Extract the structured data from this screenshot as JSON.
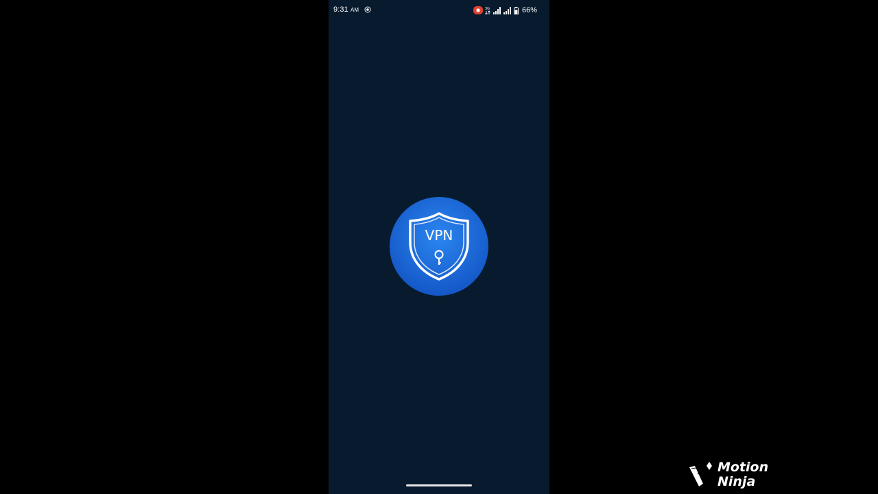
{
  "status_bar": {
    "time": "9:31",
    "ampm": "AM",
    "network_label": "3G",
    "battery_percent": "66%"
  },
  "splash": {
    "logo_text": "VPN",
    "logo_icon": "shield-key-icon",
    "colors": {
      "background": "#081a2e",
      "logo_circle": "#1e72e0",
      "logo_line": "#ffffff"
    }
  },
  "watermark": {
    "line1": "Motion",
    "line2": "Ninja"
  }
}
